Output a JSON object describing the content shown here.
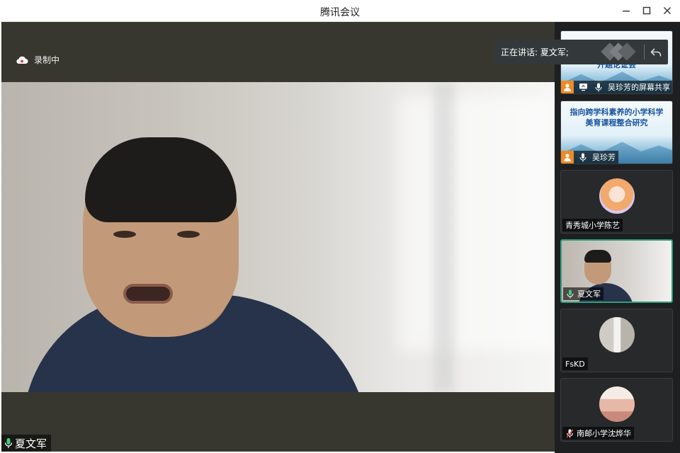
{
  "window": {
    "title": "腾讯会议"
  },
  "stage": {
    "recording_label": "录制中",
    "main_speaker_name": "夏文军"
  },
  "speaking_toast": {
    "text": "正在讲话: 夏文军;"
  },
  "participants": [
    {
      "label": "吴珍芳的屏幕共享",
      "kind": "screen-share",
      "slide_title": "开题论证会"
    },
    {
      "label": "吴珍芳",
      "kind": "slide-video",
      "slide_title": "指向跨学科素养的小学科学\n美育课程整合研究"
    },
    {
      "label": "青秀城小学陈艺",
      "kind": "avatar"
    },
    {
      "label": "夏文军",
      "kind": "video"
    },
    {
      "label": "FsKD",
      "kind": "avatar"
    },
    {
      "label": "南邮小学沈烨华",
      "kind": "avatar"
    }
  ],
  "colors": {
    "accent_green": "#2f9e7a",
    "orange_badge": "#f08a24",
    "stage_bg": "#37372f",
    "sidebar_bg": "#1d1f21"
  }
}
